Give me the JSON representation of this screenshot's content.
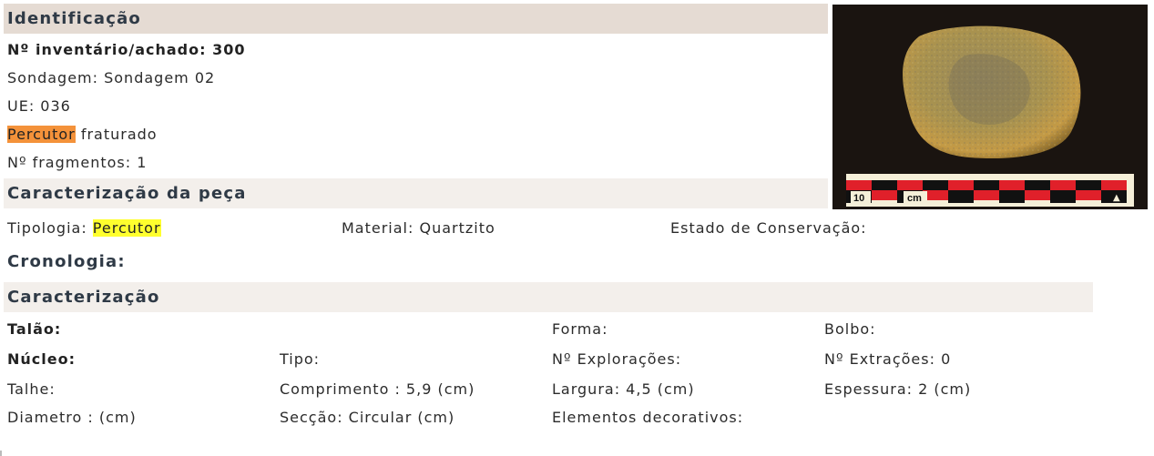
{
  "identificacao": {
    "heading": "Identificação",
    "inventario": "Nº inventário/achado: 300",
    "sondagem": "Sondagem: Sondagem 02",
    "ue": "UE: 036",
    "tipo_highlight": "Percutor",
    "tipo_rest": " fraturado",
    "fragmentos": "Nº fragmentos: 1"
  },
  "photo": {
    "scale_number": "10",
    "scale_unit": "cm",
    "scale_arrow": "▲"
  },
  "caracterizacao_peca": {
    "heading": "Caracterização da peça",
    "tipologia_label": "Tipologia: ",
    "tipologia_value": "Percutor",
    "material": "Material: Quartzito",
    "estado": "Estado de Conservação:"
  },
  "cronologia": {
    "heading": "Cronologia:"
  },
  "caracterizacao": {
    "heading": "Caracterização",
    "talao": "Talão:",
    "forma": "Forma:",
    "bolbo": "Bolbo:",
    "nucleo": "Núcleo:",
    "tipo": "Tipo:",
    "exploracoes": "Nº Explorações:",
    "extracoes": "Nº Extrações: 0",
    "talhe": "Talhe:",
    "comprimento": "Comprimento : 5,9 (cm)",
    "largura": "Largura: 4,5 (cm)",
    "espessura": "Espessura: 2 (cm)",
    "diametro": "Diametro : (cm)",
    "seccao": "Secção: Circular (cm)",
    "elementos": "Elementos decorativos:"
  },
  "colors": {
    "header_bar": "#e5dbd3",
    "section_bar": "#f3efeb",
    "highlight_orange": "#f4923a",
    "highlight_yellow": "#ffff2e"
  }
}
